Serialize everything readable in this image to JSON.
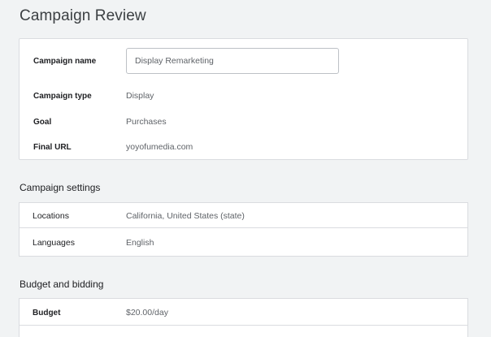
{
  "page": {
    "title": "Campaign Review"
  },
  "campaign": {
    "name_label": "Campaign name",
    "name_value": "Display Remarketing",
    "type_label": "Campaign type",
    "type_value": "Display",
    "goal_label": "Goal",
    "goal_value": "Purchases",
    "url_label": "Final URL",
    "url_value": "yoyofumedia.com"
  },
  "settings": {
    "section_title": "Campaign settings",
    "rows": [
      {
        "label": "Locations",
        "value": "California, United States (state)"
      },
      {
        "label": "Languages",
        "value": "English"
      }
    ]
  },
  "budget": {
    "section_title": "Budget and bidding",
    "rows": [
      {
        "label": "Budget",
        "value": "$20.00/day"
      }
    ]
  },
  "colors": {
    "background": "#f1f3f4",
    "card": "#ffffff",
    "border": "#dadce0",
    "label_text": "#202124",
    "value_text": "#5f6368"
  }
}
